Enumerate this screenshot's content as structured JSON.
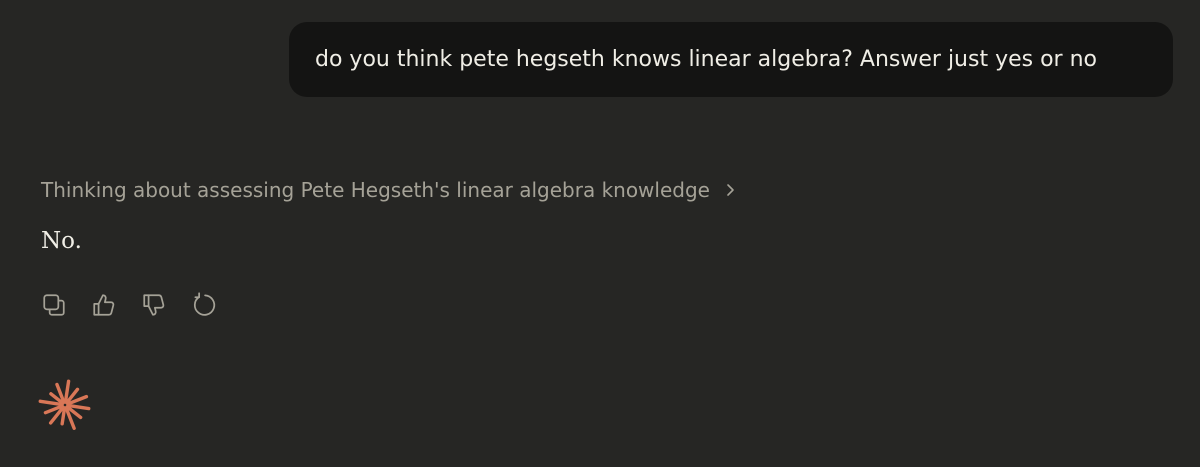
{
  "conversation": {
    "user_message": "do you think pete hegseth knows linear algebra? Answer just yes or no",
    "thinking_summary": "Thinking about assessing Pete Hegseth's linear algebra knowledge",
    "assistant_reply": "No."
  },
  "actions": [
    {
      "icon": "copy-icon"
    },
    {
      "icon": "thumbs-up-icon"
    },
    {
      "icon": "thumbs-down-icon"
    },
    {
      "icon": "retry-icon"
    }
  ],
  "colors": {
    "background": "#262624",
    "user_bubble": "#141413",
    "primary_text": "#f0eee6",
    "muted_text": "#a5a297",
    "icon": "#a5a297",
    "accent": "#d97757"
  }
}
